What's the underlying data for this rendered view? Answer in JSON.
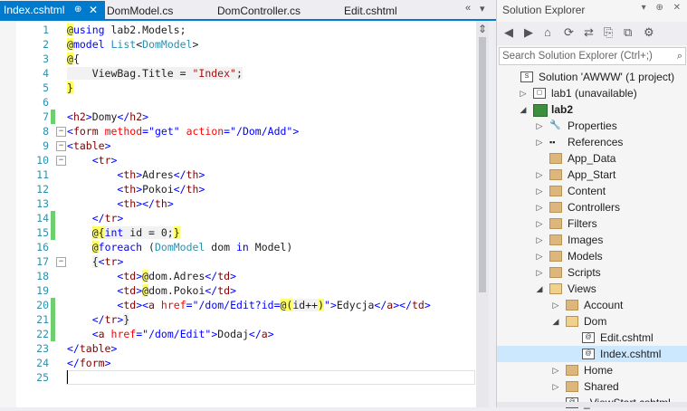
{
  "tabs": {
    "active": {
      "label": "Index.cshtml",
      "pin": "⊕",
      "close": "✕"
    },
    "others": [
      "DomModel.cs",
      "DomController.cs",
      "Edit.cshtml"
    ],
    "scroll_glyph": "«",
    "dropdown_glyph": "▾"
  },
  "editor": {
    "lines": [
      {
        "n": "1",
        "code": "<span class='at'>@</span><span class='rel'>using</span> lab2.Models;"
      },
      {
        "n": "2",
        "code": "<span class='at'>@</span><span class='rel'>model</span> <span class='ty'>List</span>&lt;<span class='ty'>DomModel</span>&gt;"
      },
      {
        "n": "3",
        "code": "<span class='at'>@</span>{"
      },
      {
        "n": "4",
        "code": "<span class='razorbg'>    ViewBag.Title = <span class='str'>\"Index\"</span>;</span>"
      },
      {
        "n": "5",
        "code": "<span class='at'>}</span>"
      },
      {
        "n": "6",
        "code": ""
      },
      {
        "n": "7",
        "code": "<span class='ent'>&lt;</span><span class='tag'>h2</span><span class='ent'>&gt;</span>Domy<span class='ent'>&lt;/</span><span class='tag'>h2</span><span class='ent'>&gt;</span>"
      },
      {
        "n": "8",
        "code": "<span class='ent'>&lt;</span><span class='tag'>form</span> <span class='attr'>method</span><span class='ent'>=</span><span class='rel'>\"get\"</span> <span class='attr'>action</span><span class='ent'>=</span><span class='rel'>\"/Dom/Add\"</span><span class='ent'>&gt;</span>"
      },
      {
        "n": "9",
        "code": "<span class='ent'>&lt;</span><span class='tag'>table</span><span class='ent'>&gt;</span>"
      },
      {
        "n": "10",
        "code": "    <span class='ent'>&lt;</span><span class='tag'>tr</span><span class='ent'>&gt;</span>"
      },
      {
        "n": "11",
        "code": "        <span class='ent'>&lt;</span><span class='tag'>th</span><span class='ent'>&gt;</span>Adres<span class='ent'>&lt;/</span><span class='tag'>th</span><span class='ent'>&gt;</span>"
      },
      {
        "n": "12",
        "code": "        <span class='ent'>&lt;</span><span class='tag'>th</span><span class='ent'>&gt;</span>Pokoi<span class='ent'>&lt;/</span><span class='tag'>th</span><span class='ent'>&gt;</span>"
      },
      {
        "n": "13",
        "code": "        <span class='ent'>&lt;</span><span class='tag'>th</span><span class='ent'>&gt;&lt;/</span><span class='tag'>th</span><span class='ent'>&gt;</span>"
      },
      {
        "n": "14",
        "code": "    <span class='ent'>&lt;/</span><span class='tag'>tr</span><span class='ent'>&gt;</span>"
      },
      {
        "n": "15",
        "code": "    <span class='at'>@{</span><span class='razorbg'><span class='rel'>int</span> id = 0;</span><span class='at'>}</span>"
      },
      {
        "n": "16",
        "code": "    <span class='at'>@</span><span class='rel'>foreach</span> (<span class='ty'>DomModel</span> dom <span class='rel'>in</span> Model)"
      },
      {
        "n": "17",
        "code": "    <span class='razorbg'>{</span><span class='ent'>&lt;</span><span class='tag'>tr</span><span class='ent'>&gt;</span>"
      },
      {
        "n": "18",
        "code": "        <span class='ent'>&lt;</span><span class='tag'>td</span><span class='ent'>&gt;</span><span class='at'>@</span>dom.Adres<span class='ent'>&lt;/</span><span class='tag'>td</span><span class='ent'>&gt;</span>"
      },
      {
        "n": "19",
        "code": "        <span class='ent'>&lt;</span><span class='tag'>td</span><span class='ent'>&gt;</span><span class='at'>@</span>dom.Pokoi<span class='ent'>&lt;/</span><span class='tag'>td</span><span class='ent'>&gt;</span>"
      },
      {
        "n": "20",
        "code": "        <span class='ent'>&lt;</span><span class='tag'>td</span><span class='ent'>&gt;&lt;</span><span class='tag'>a</span> <span class='attr'>href</span><span class='ent'>=</span><span class='rel'>\"/dom/Edit?id=</span><span class='at'>@(</span><span class='razorbg'>id++</span><span class='at'>)</span><span class='rel'>\"</span><span class='ent'>&gt;</span>Edycja<span class='ent'>&lt;/</span><span class='tag'>a</span><span class='ent'>&gt;&lt;/</span><span class='tag'>td</span><span class='ent'>&gt;</span>"
      },
      {
        "n": "21",
        "code": "    <span class='ent'>&lt;/</span><span class='tag'>tr</span><span class='ent'>&gt;</span><span class='razorbg'>}</span>"
      },
      {
        "n": "22",
        "code": "    <span class='ent'>&lt;</span><span class='tag'>a</span> <span class='attr'>href</span><span class='ent'>=</span><span class='rel'>\"/dom/Edit\"</span><span class='ent'>&gt;</span>Dodaj<span class='ent'>&lt;/</span><span class='tag'>a</span><span class='ent'>&gt;</span>"
      },
      {
        "n": "23",
        "code": "<span class='ent'>&lt;/</span><span class='tag'>table</span><span class='ent'>&gt;</span>"
      },
      {
        "n": "24",
        "code": "<span class='ent'>&lt;/</span><span class='tag'>form</span><span class='ent'>&gt;</span>"
      },
      {
        "n": "25",
        "code": ""
      }
    ],
    "changed_lines": [
      7,
      14,
      15,
      20,
      21,
      22
    ],
    "fold_lines": [
      8,
      9,
      10,
      17
    ]
  },
  "explorer": {
    "title": "Solution Explorer",
    "title_ctrls": "▾ ⊕ ✕",
    "search_placeholder": "Search Solution Explorer (Ctrl+;)",
    "search_icon": "⌕",
    "toolbar": [
      "◀",
      "▶",
      "⌂",
      "⟳",
      "⇄",
      "⎘",
      "⧉",
      "⚙"
    ],
    "nodes": [
      {
        "label": "Solution 'AWWW' (1 project)",
        "depth": 0,
        "exp": "",
        "icon": "solution"
      },
      {
        "label": "lab1 (unavailable)",
        "depth": 1,
        "exp": "▷",
        "icon": "project"
      },
      {
        "label": "lab2",
        "depth": 1,
        "exp": "◢",
        "icon": "web",
        "bold": true
      },
      {
        "label": "Properties",
        "depth": 2,
        "exp": "▷",
        "icon": "wrench"
      },
      {
        "label": "References",
        "depth": 2,
        "exp": "▷",
        "icon": "refs"
      },
      {
        "label": "App_Data",
        "depth": 2,
        "exp": "",
        "icon": "folder"
      },
      {
        "label": "App_Start",
        "depth": 2,
        "exp": "▷",
        "icon": "folder"
      },
      {
        "label": "Content",
        "depth": 2,
        "exp": "▷",
        "icon": "folder"
      },
      {
        "label": "Controllers",
        "depth": 2,
        "exp": "▷",
        "icon": "folder"
      },
      {
        "label": "Filters",
        "depth": 2,
        "exp": "▷",
        "icon": "folder"
      },
      {
        "label": "Images",
        "depth": 2,
        "exp": "▷",
        "icon": "folder"
      },
      {
        "label": "Models",
        "depth": 2,
        "exp": "▷",
        "icon": "folder"
      },
      {
        "label": "Scripts",
        "depth": 2,
        "exp": "▷",
        "icon": "folder"
      },
      {
        "label": "Views",
        "depth": 2,
        "exp": "◢",
        "icon": "folder-open"
      },
      {
        "label": "Account",
        "depth": 3,
        "exp": "▷",
        "icon": "folder"
      },
      {
        "label": "Dom",
        "depth": 3,
        "exp": "◢",
        "icon": "folder-open"
      },
      {
        "label": "Edit.cshtml",
        "depth": 4,
        "exp": "",
        "icon": "file"
      },
      {
        "label": "Index.cshtml",
        "depth": 4,
        "exp": "",
        "icon": "file",
        "selected": true
      },
      {
        "label": "Home",
        "depth": 3,
        "exp": "▷",
        "icon": "folder"
      },
      {
        "label": "Shared",
        "depth": 3,
        "exp": "▷",
        "icon": "folder"
      },
      {
        "label": "_ViewStart.cshtml",
        "depth": 3,
        "exp": "",
        "icon": "file"
      }
    ]
  },
  "colors": {
    "accent": "#007acc",
    "selection": "#cce8ff",
    "changed": "#6fcf6f"
  }
}
